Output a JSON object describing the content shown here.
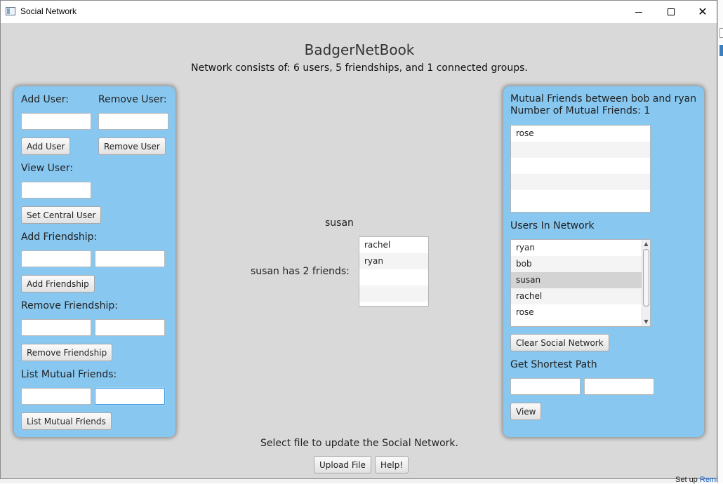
{
  "window": {
    "title": "Social Network",
    "icons": {
      "app": "window-app-icon",
      "minimize": "minimize-icon",
      "maximize": "maximize-icon",
      "close": "close-icon"
    }
  },
  "header": {
    "title": "BadgerNetBook",
    "summary": "Network consists of: 6 users, 5 friendships, and 1 connected groups."
  },
  "left_panel": {
    "add_user_label": "Add User:",
    "remove_user_label": "Remove User:",
    "add_user_button": "Add User",
    "remove_user_button": "Remove User",
    "view_user_label": "View User:",
    "set_central_button": "Set Central User",
    "add_friendship_label": "Add Friendship:",
    "add_friendship_button": "Add Friendship",
    "remove_friendship_label": "Remove Friendship:",
    "remove_friendship_button": "Remove Friendship",
    "list_mutual_label": "List Mutual Friends:",
    "list_mutual_button": "List Mutual Friends"
  },
  "center": {
    "central_user": "susan",
    "friends_count_text": "susan has 2 friends:",
    "friends": [
      "rachel",
      "ryan",
      "",
      "",
      ""
    ]
  },
  "right_panel": {
    "mutual_title": "Mutual Friends between bob and ryan",
    "mutual_count": "Number of Mutual Friends: 1",
    "mutual_list": [
      "rose",
      "",
      "",
      "",
      ""
    ],
    "users_label": "Users In Network",
    "users": [
      "ryan",
      "bob",
      "susan",
      "rachel",
      "rose"
    ],
    "selected_user": "susan",
    "clear_button": "Clear Social Network",
    "shortest_path_label": "Get Shortest Path",
    "view_button": "View"
  },
  "footer": {
    "text": "Select file to update the Social Network.",
    "upload_button": "Upload File",
    "help_button": "Help!"
  },
  "background": {
    "setup_text": "Set up",
    "setup_link": "Remi"
  },
  "colors": {
    "panel": "#87c7f0",
    "window_bg": "#d9d9d9",
    "focus": "#3d9be0"
  }
}
